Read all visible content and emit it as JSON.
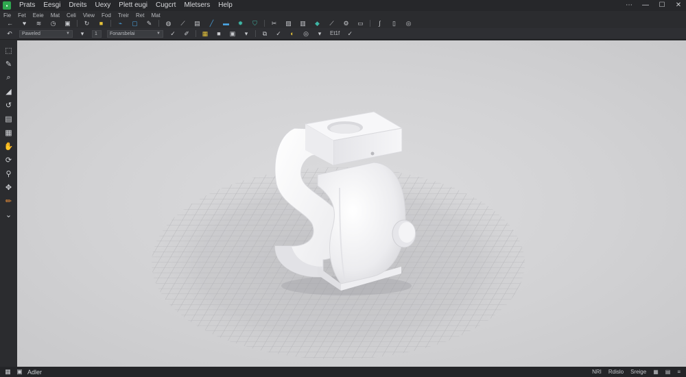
{
  "menu": [
    "Prats",
    "Eesgi",
    "Dreits",
    "Uexy",
    "Plett eugi",
    "Cugcrt",
    "Mletsers",
    "Help"
  ],
  "submenu": [
    "Fie",
    "Fet",
    "Eeie",
    "Mat",
    "Celi",
    "View",
    "Fod",
    "Treir",
    "Ret",
    "Mat"
  ],
  "toolbar": {
    "dropdown1": "Paweled",
    "dropdown2": "Fonarsbelai",
    "dropdown_num": "1",
    "readout": "Et1f"
  },
  "status": {
    "label": "Adler",
    "right": [
      "NRI",
      "Rdislo",
      "Sreige"
    ]
  },
  "colors": {
    "accent_green": "#2fa84f",
    "accent_yellow": "#e6c339",
    "accent_blue": "#4aa3e0",
    "accent_teal": "#3fb7a6",
    "accent_orange": "#e08a3a"
  }
}
